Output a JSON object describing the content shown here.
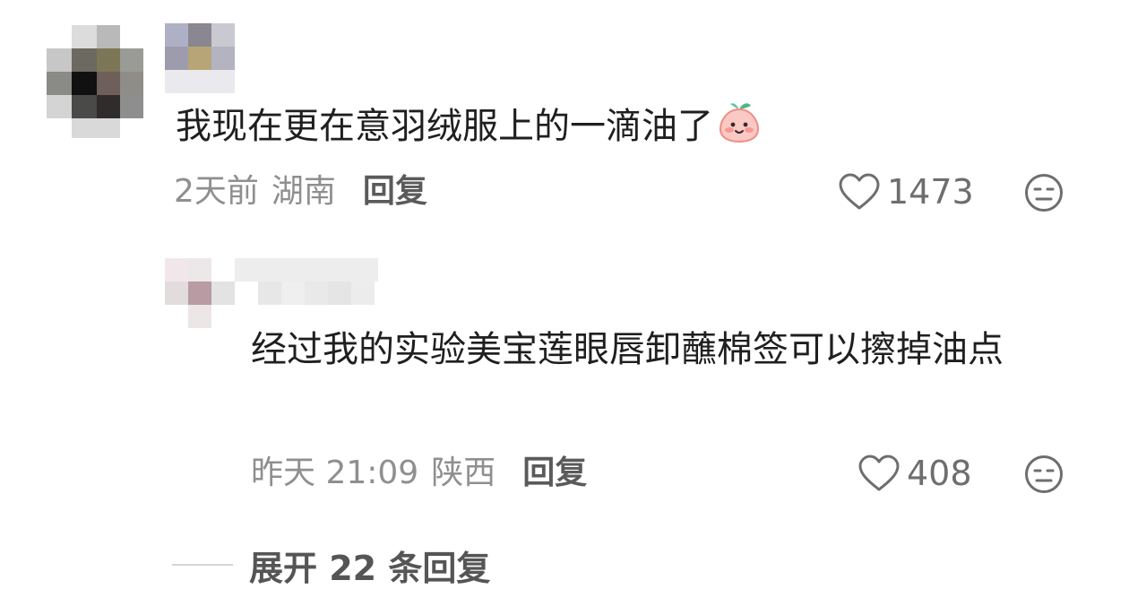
{
  "comment": {
    "text": "我现在更在意羽绒服上的一滴油了",
    "emoji_icon": "peach-face-emoji",
    "time": "2天前",
    "location": "湖南",
    "reply_label": "回复",
    "likes": "1473"
  },
  "sub_comment": {
    "text": "经过我的实验美宝莲眼唇卸蘸棉签可以擦掉油点",
    "time": "昨天 21:09",
    "location": "陕西",
    "reply_label": "回复",
    "likes": "408"
  },
  "expand": {
    "label": "展开 22 条回复"
  },
  "colors": {
    "text_primary": "#1f1f1f",
    "text_meta": "#8f8f8f",
    "action": "#5a5a5a",
    "icon": "#6e6e6e"
  }
}
